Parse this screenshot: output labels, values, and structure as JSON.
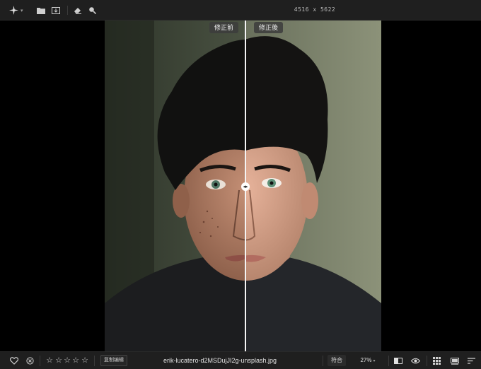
{
  "toolbar": {
    "icons": [
      "sparkle-icon",
      "folder-icon",
      "image-import-icon",
      "eraser-icon",
      "search-icon"
    ],
    "dimensions": "4516 x 5622"
  },
  "compare": {
    "before_label": "修正前",
    "after_label": "修正後"
  },
  "statusbar": {
    "copy_edit_label": "复制编辑",
    "filename": "erik-lucatero-d2MSDujJI2g-unsplash.jpg",
    "fit_label": "符合",
    "zoom_value": "27%",
    "rating_stars": 5,
    "rating_value": 0
  },
  "colors": {
    "bar_bg": "#1f1f1f",
    "photo_bg": "#3a4134",
    "split_line": "#f4f4f4"
  }
}
